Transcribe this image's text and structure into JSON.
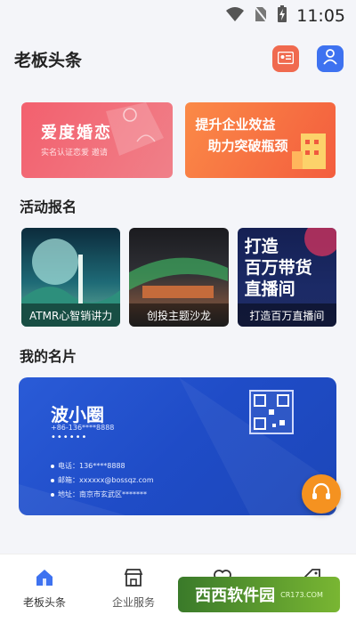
{
  "status_bar": {
    "time": "11:05"
  },
  "app_bar": {
    "title": "老板头条"
  },
  "banners": [
    {
      "title": "爱度婚恋",
      "subtitle": "实名认证恋爱   邀请"
    },
    {
      "line1": "提升企业效益",
      "line2": "助力突破瓶颈"
    }
  ],
  "sections": {
    "activities": "活动报名",
    "my_card": "我的名片"
  },
  "activities": [
    {
      "label": "ATMR心智销讲力"
    },
    {
      "label": "创投主题沙龙"
    },
    {
      "label": "打造百万直播间",
      "poster_lines": [
        "打造",
        "百万带货",
        "直播间"
      ]
    }
  ],
  "business_card": {
    "name": "波小圈",
    "phone_line": "+86-136****8888",
    "dots": "••••••",
    "rows": [
      "电话：136****8888",
      "邮箱：xxxxxx@bossqz.com",
      "地址：南京市玄武区*******"
    ]
  },
  "bottom_nav": {
    "items": [
      {
        "label": "老板头条",
        "icon": "home-icon"
      },
      {
        "label": "企业服务",
        "icon": "store-icon"
      },
      {
        "label": "",
        "icon": "heart-icon"
      },
      {
        "label": "",
        "icon": "tag-icon"
      }
    ]
  },
  "watermark": {
    "text": "西西软件园",
    "site": "CR173.COM"
  },
  "colors": {
    "accent": "#3e72f0",
    "card_blue": "#2250cc",
    "fab_orange": "#f59220"
  }
}
